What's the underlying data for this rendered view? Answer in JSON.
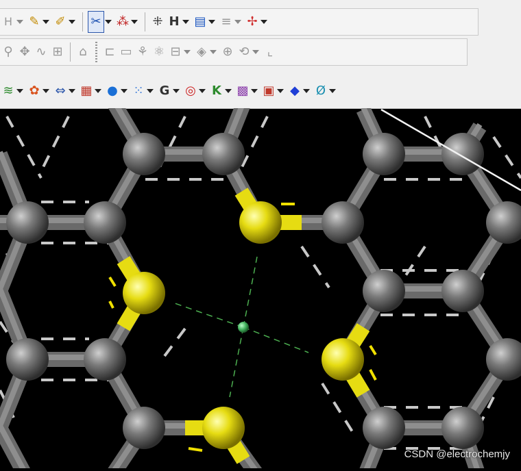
{
  "toolbar_row1": {
    "items": [
      {
        "name": "hydrogen-tool",
        "glyph": "H"
      },
      {
        "name": "sketch-pencil-icon",
        "glyph": "✎"
      },
      {
        "name": "edit-pencil-icon",
        "glyph": "✐"
      },
      {
        "name": "bond-adjust-icon",
        "glyph": "✂"
      },
      {
        "name": "atom-scatter-icon",
        "glyph": "⁂"
      },
      {
        "name": "fragment-icon",
        "glyph": "⁜"
      },
      {
        "name": "hydrogen-add-icon",
        "glyph": "H"
      },
      {
        "name": "measure-icon",
        "glyph": "▤"
      },
      {
        "name": "lines-icon",
        "glyph": "≡"
      },
      {
        "name": "move-atom-icon",
        "glyph": "✢"
      }
    ]
  },
  "toolbar_row2": {
    "items": [
      {
        "name": "zoom-icon",
        "glyph": "⚲"
      },
      {
        "name": "pan-icon",
        "glyph": "✥"
      },
      {
        "name": "spectrum-icon",
        "glyph": "∿"
      },
      {
        "name": "circuit-icon",
        "glyph": "⊞"
      },
      {
        "name": "home-icon",
        "glyph": "⌂"
      },
      {
        "name": "tree-icon",
        "glyph": "⊏"
      },
      {
        "name": "ruler-icon",
        "glyph": "▭"
      },
      {
        "name": "branch-icon",
        "glyph": "⚘"
      },
      {
        "name": "molecule-icon",
        "glyph": "⚛"
      },
      {
        "name": "grid-icon",
        "glyph": "⊟"
      },
      {
        "name": "crystal-icon",
        "glyph": "◈"
      },
      {
        "name": "lattice-icon",
        "glyph": "⊕"
      },
      {
        "name": "rotate-icon",
        "glyph": "⟲"
      },
      {
        "name": "chart-icon",
        "glyph": "⌞"
      }
    ]
  },
  "toolbar_row3": {
    "items": [
      {
        "name": "wave-icon",
        "glyph": "≋",
        "color": "#2e8b2e"
      },
      {
        "name": "orbital-icon",
        "glyph": "✿",
        "color": "#d9531e"
      },
      {
        "name": "bracket-icon",
        "glyph": "⇔",
        "color": "#2a55aa"
      },
      {
        "name": "table-icon",
        "glyph": "▦",
        "color": "#c0392b"
      },
      {
        "name": "balls-icon",
        "glyph": "●",
        "color": "#1a6fd6"
      },
      {
        "name": "cluster-icon",
        "glyph": "⁙",
        "color": "#3a7ad9"
      },
      {
        "name": "gaussian-icon",
        "glyph": "G",
        "color": "#333333"
      },
      {
        "name": "target-icon",
        "glyph": "◎",
        "color": "#cc2222"
      },
      {
        "name": "k-point-icon",
        "glyph": "K",
        "color": "#2e8b2e"
      },
      {
        "name": "texture-icon",
        "glyph": "▩",
        "color": "#8e44ad"
      },
      {
        "name": "dots-icon",
        "glyph": "▣",
        "color": "#c0392b"
      },
      {
        "name": "gem-icon",
        "glyph": "◆",
        "color": "#1f3fd6"
      },
      {
        "name": "spectrum-n-icon",
        "glyph": "Ø",
        "color": "#1a8fb0"
      }
    ]
  },
  "colors": {
    "carbon": "#6e6e6e",
    "sulfur": "#e6dc12",
    "center_atom": "#3fae5a",
    "dash_white": "#c8c8c8",
    "dash_yellow": "#f0e000",
    "guide": "#4caf50"
  },
  "watermark": "CSDN @electrochemjy"
}
